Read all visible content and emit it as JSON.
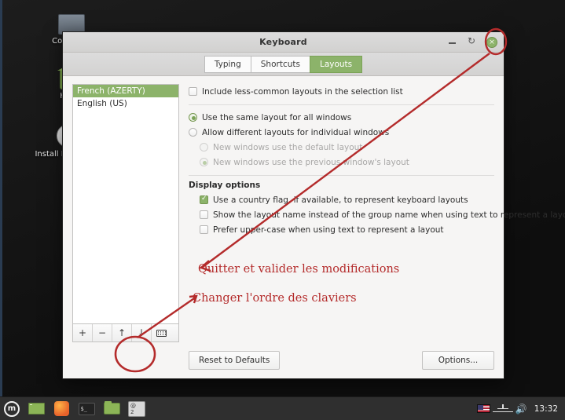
{
  "desktop": {
    "icons": [
      {
        "name": "computer",
        "label": "Computer"
      },
      {
        "name": "home",
        "label": "Home"
      },
      {
        "name": "install",
        "label": "Install Linux Mint"
      }
    ]
  },
  "window": {
    "title": "Keyboard",
    "buttons": {
      "minimize": "–",
      "maximize": "↻",
      "close": "×"
    },
    "tabs": [
      {
        "label": "Typing",
        "active": false
      },
      {
        "label": "Shortcuts",
        "active": false
      },
      {
        "label": "Layouts",
        "active": true
      }
    ],
    "layouts": {
      "items": [
        {
          "label": "French (AZERTY)",
          "selected": true
        },
        {
          "label": "English (US)",
          "selected": false
        }
      ],
      "toolbar": [
        {
          "name": "add-layout-button",
          "glyph": "+"
        },
        {
          "name": "remove-layout-button",
          "glyph": "−"
        },
        {
          "name": "move-layout-up-button",
          "glyph": "↑"
        },
        {
          "name": "move-layout-down-button",
          "glyph": "↓"
        },
        {
          "name": "show-keyboard-layout-button",
          "glyph": ""
        }
      ]
    },
    "options": {
      "include_less_common": "Include less-common layouts in the selection list",
      "same_layout": "Use the same layout for all windows",
      "different_layouts": "Allow different layouts for individual windows",
      "new_default": "New windows use the default layout",
      "new_previous": "New windows use the previous window's layout",
      "display_options_title": "Display options",
      "country_flag": "Use a country flag, if available, to represent keyboard layouts",
      "layout_name": "Show the layout name instead of the group name when using text to represent a layout",
      "upper_case": "Prefer upper-case when using text to represent a layout"
    },
    "footer": {
      "reset_label": "Reset to Defaults",
      "options_label": "Options..."
    }
  },
  "annotations": {
    "quitter": "Quitter et valider les modifications",
    "changer": "Changer l'ordre des claviers",
    "color": "#b42b2b"
  },
  "taskbar": {
    "menu_label": "m",
    "items": [
      {
        "name": "taskbar-window-item",
        "label": ""
      },
      {
        "name": "taskbar-firefox-item",
        "label": ""
      },
      {
        "name": "taskbar-terminal-item",
        "label": "$_"
      },
      {
        "name": "taskbar-files-item",
        "label": ""
      }
    ],
    "workspace": {
      "line1": "@",
      "line2": "2"
    },
    "tray": {
      "keyboard_flag": "US",
      "network": "network-icon",
      "volume": "🔊",
      "clock": "13:32"
    }
  },
  "colors": {
    "accent_green": "#8cb36a",
    "annotation_red": "#b42b2b",
    "window_bg": "#f6f5f4",
    "taskbar_bg": "#2f2f2f"
  }
}
